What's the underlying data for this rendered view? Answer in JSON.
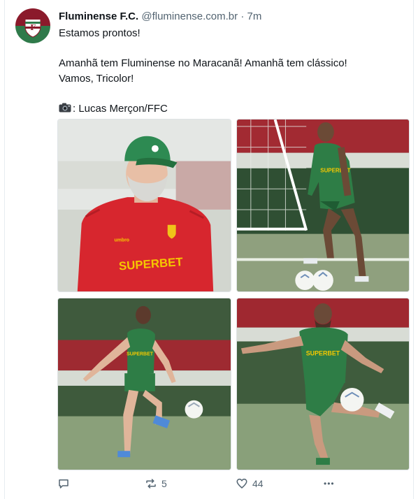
{
  "tweet": {
    "author_name": "Fluminense F.C.",
    "author_handle": "@fluminense.com.br",
    "separator": "·",
    "timestamp": "7m",
    "lines": [
      "Estamos prontos!",
      "",
      "Amanhã tem Fluminense no Maracanã! Amanhã tem clássico!",
      "Vamos, Tricolor!",
      ""
    ],
    "credit": ": Lucas Merçon/FFC",
    "credit_icon": "camera-icon"
  },
  "photos": [
    {
      "kind": "coach-portrait",
      "sponsor_text": "SUPERBET"
    },
    {
      "kind": "player-juggling-near-goal",
      "sponsor_text": "SUPERBET"
    },
    {
      "kind": "player-kicking-ball",
      "sponsor_text": "SUPERBET"
    },
    {
      "kind": "player-kicking-ball-bearded",
      "sponsor_text": "SUPERBET"
    }
  ],
  "actions": {
    "reply": {
      "icon": "reply-icon",
      "count": ""
    },
    "retweet": {
      "icon": "retweet-icon",
      "count": "5"
    },
    "like": {
      "icon": "heart-icon",
      "count": "44"
    },
    "more": {
      "icon": "more-icon",
      "label": "•••"
    }
  },
  "colors": {
    "text": "#0f1419",
    "muted": "#536471",
    "club_maroon": "#8b1a2b",
    "club_green": "#2f7a4a",
    "kit_green": "#2e7d46",
    "kit_red": "#d7262e"
  }
}
